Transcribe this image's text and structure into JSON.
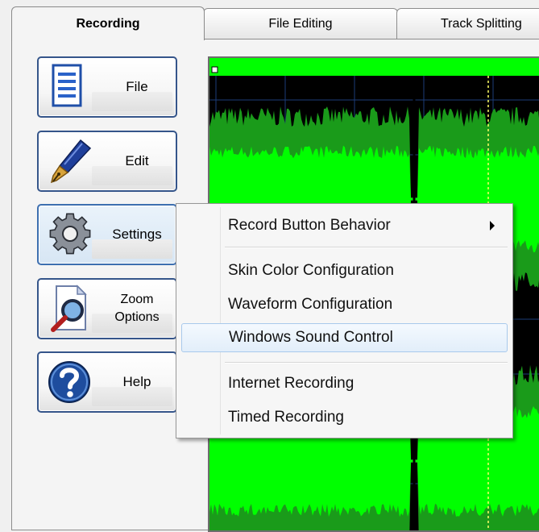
{
  "tabs": [
    {
      "label": "Recording",
      "active": true
    },
    {
      "label": "File Editing",
      "active": false
    },
    {
      "label": "Track Splitting",
      "active": false
    }
  ],
  "sidebar": {
    "buttons": [
      {
        "label": "File",
        "icon": "document-icon"
      },
      {
        "label": "Edit",
        "icon": "fountain-pen-icon"
      },
      {
        "label": "Settings",
        "icon": "gear-icon"
      },
      {
        "label": "Zoom Options",
        "icon": "magnifier-document-icon"
      },
      {
        "label": "Help",
        "icon": "question-mark-icon"
      }
    ]
  },
  "context_menu": {
    "items": [
      {
        "label": "Record Button Behavior",
        "submenu": true
      },
      {
        "label": "Skin Color Configuration"
      },
      {
        "label": "Waveform Configuration"
      },
      {
        "label": "Windows Sound Control",
        "highlighted": true
      },
      {
        "label": "Internet Recording"
      },
      {
        "label": "Timed Recording"
      }
    ]
  },
  "colors": {
    "waveform_bright": "#00ff00",
    "waveform_dark": "#1a9b1a",
    "waveform_background": "#000000",
    "grid": "#1c3c78",
    "playhead": "#ffff66",
    "button_border": "#35558a",
    "menu_highlight": "#a8c9ec"
  }
}
